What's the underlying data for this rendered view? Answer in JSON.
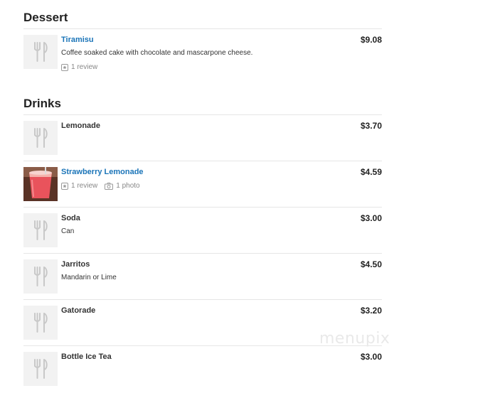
{
  "sections": [
    {
      "title": "Dessert",
      "items": [
        {
          "name": "Tiramisu",
          "price": "$9.08",
          "description": "Coffee soaked cake with chocolate and mascarpone cheese.",
          "reviews": "1 review",
          "photos": null,
          "linked": true,
          "thumb": "utensils-placeholder-icon"
        }
      ]
    },
    {
      "title": "Drinks",
      "items": [
        {
          "name": "Lemonade",
          "price": "$3.70",
          "description": null,
          "reviews": null,
          "photos": null,
          "linked": false,
          "thumb": "utensils-placeholder-icon"
        },
        {
          "name": "Strawberry Lemonade",
          "price": "$4.59",
          "description": null,
          "reviews": "1 review",
          "photos": "1 photo",
          "linked": true,
          "thumb": "drink-photo"
        },
        {
          "name": "Soda",
          "price": "$3.00",
          "description": "Can",
          "reviews": null,
          "photos": null,
          "linked": false,
          "thumb": "utensils-placeholder-icon"
        },
        {
          "name": "Jarritos",
          "price": "$4.50",
          "description": "Mandarin or Lime",
          "reviews": null,
          "photos": null,
          "linked": false,
          "thumb": "utensils-placeholder-icon"
        },
        {
          "name": "Gatorade",
          "price": "$3.20",
          "description": null,
          "reviews": null,
          "photos": null,
          "linked": false,
          "thumb": "utensils-placeholder-icon"
        },
        {
          "name": "Bottle Ice Tea",
          "price": "$3.00",
          "description": null,
          "reviews": null,
          "photos": null,
          "linked": false,
          "thumb": "utensils-placeholder-icon"
        }
      ]
    }
  ],
  "watermark": "menupix",
  "colors": {
    "link": "#1a74b8",
    "text": "#333333",
    "divider": "#e6e6e6",
    "placeholder_bg": "#f2f2f2"
  }
}
